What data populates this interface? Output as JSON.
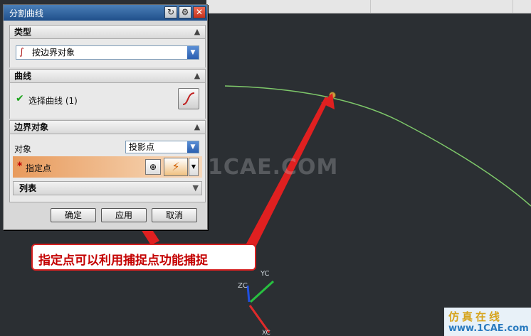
{
  "dialog": {
    "title": "分割曲线",
    "buttons": {
      "ok": "确定",
      "apply": "应用",
      "cancel": "取消"
    }
  },
  "sections": {
    "type": {
      "header": "类型",
      "selected": "按边界对象"
    },
    "curve": {
      "header": "曲线",
      "select_label": "选择曲线 (1)"
    },
    "boundary": {
      "header": "边界对象",
      "object_label": "对象",
      "object_value": "投影点",
      "point_label": "指定点",
      "required_mark": "*",
      "list_label": "列表"
    }
  },
  "annotation": {
    "text": "指定点可以利用捕捉点功能捕捉"
  },
  "watermark": "1CAE.COM",
  "logo": {
    "line1": "仿真在线",
    "line2": "www.1CAE.com"
  },
  "axes": {
    "xc": "XC",
    "yc": "YC",
    "zc": "ZC"
  },
  "colors": {
    "curve": "#7ec86a",
    "arrow": "#e02020",
    "point": "#c8a040",
    "title_bar": "#2a5f9e",
    "highlight_row": "#e8a46a"
  },
  "icons": {
    "curve_type": "s-curve-icon",
    "check": "checkmark-icon",
    "point_constructor": "point-dialog-icon",
    "snap": "snap-point-icon",
    "reset": "reset-icon",
    "settings": "gear-icon",
    "close": "close-icon"
  }
}
